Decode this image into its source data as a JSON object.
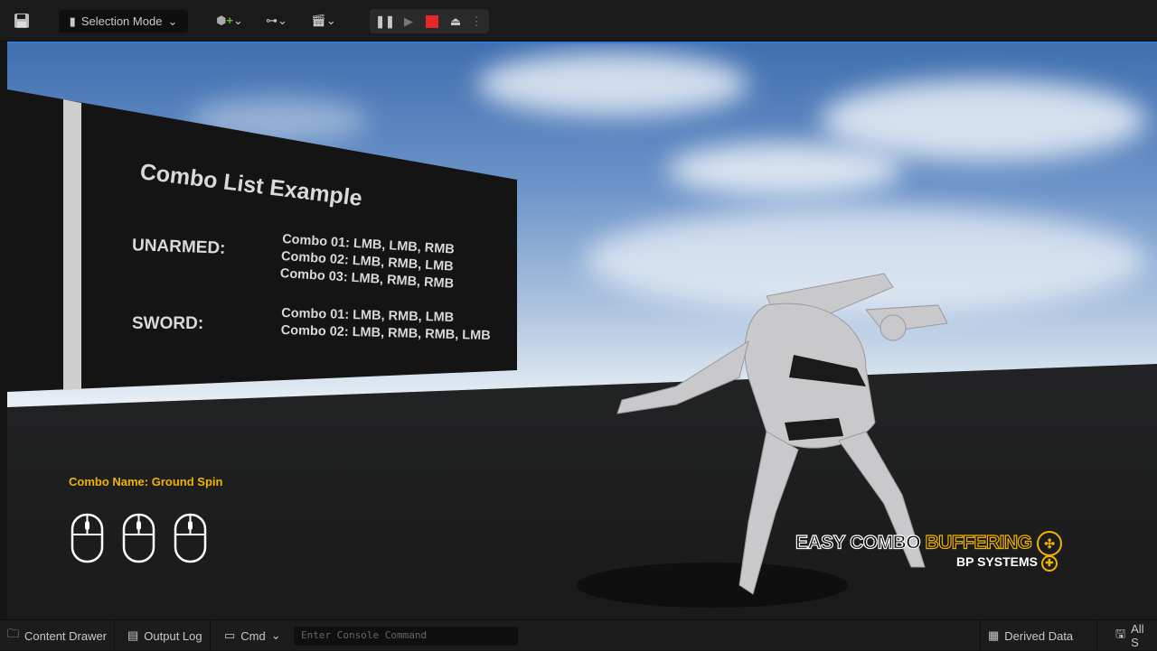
{
  "toolbar": {
    "mode_label": "Selection Mode"
  },
  "board": {
    "title": "Combo List Example",
    "groups": [
      {
        "name": "UNARMED:",
        "combos": [
          "Combo 01: LMB, LMB, RMB",
          "Combo 02: LMB, RMB, LMB",
          "Combo 03: LMB, RMB, RMB"
        ]
      },
      {
        "name": "SWORD:",
        "combos": [
          "Combo 01: LMB, RMB, LMB",
          "Combo 02: LMB, RMB, RMB, LMB"
        ]
      }
    ]
  },
  "hud": {
    "combo_name": "Combo Name: Ground Spin",
    "mouse_count": 3
  },
  "logo": {
    "line1a": "EASY COMBO",
    "line1b": "BUFFERING",
    "line2": "BP SYSTEMS"
  },
  "statusbar": {
    "content_drawer": "Content Drawer",
    "output_log": "Output Log",
    "cmd": "Cmd",
    "console_placeholder": "Enter Console Command",
    "derived_data": "Derived Data",
    "all_saved": "All S"
  },
  "colors": {
    "accent": "#f0b400",
    "stop": "#e8262b"
  }
}
